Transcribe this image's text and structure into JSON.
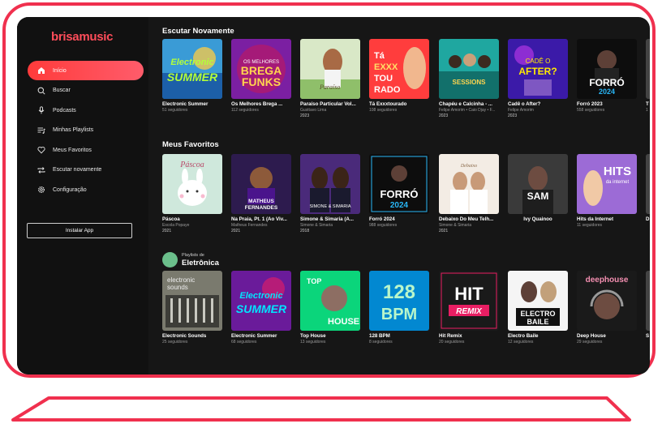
{
  "app": {
    "logo": "brisamusic"
  },
  "colors": {
    "accent": "#ff4152",
    "frame": "#f0304e",
    "bg": "#161616"
  },
  "sidebar": {
    "items": [
      {
        "label": "Início",
        "icon": "home-icon",
        "active": true
      },
      {
        "label": "Buscar",
        "icon": "search-icon"
      },
      {
        "label": "Podcasts",
        "icon": "microphone-icon"
      },
      {
        "label": "Minhas Playlists",
        "icon": "playlist-icon"
      },
      {
        "label": "Meus Favoritos",
        "icon": "heart-icon"
      },
      {
        "label": "Escutar novamente",
        "icon": "repeat-icon"
      },
      {
        "label": "Configuração",
        "icon": "gear-icon"
      }
    ],
    "install_label": "Instalar App"
  },
  "sections": {
    "listen_again": {
      "title": "Escutar Novamente",
      "cards": [
        {
          "title": "Electronic Summer",
          "sub": "51 seguidores",
          "year": "",
          "art": "ELECTRONIC SUMMER"
        },
        {
          "title": "Os Melhores Brega ...",
          "sub": "112 seguidores",
          "year": "",
          "art": "BREGA FUNKS"
        },
        {
          "title": "Paraíso Particular Vol...",
          "sub": "Gusttavo Lima",
          "year": "2023",
          "art": "Paraíso"
        },
        {
          "title": "Tá Exxxtourado",
          "sub": "108 seguidores",
          "year": "",
          "art": "TÁ EXXTOURADO"
        },
        {
          "title": "Chapéu e Calcinha - ...",
          "sub": "Felipe Amorim • Caio Djay • F...",
          "year": "2023",
          "art": "SESSIONS"
        },
        {
          "title": "Cadê o After?",
          "sub": "Felipe Amorim",
          "year": "2023",
          "art": "AFTER?"
        },
        {
          "title": "Forró 2023",
          "sub": "558 seguidores",
          "year": "",
          "art": "FORRÓ 2024"
        },
        {
          "title": "T",
          "sub": "1",
          "year": "",
          "art": ""
        }
      ]
    },
    "favorites": {
      "title": "Meus Favoritos",
      "cards": [
        {
          "title": "Páscoa",
          "sub": "Escola Popaye",
          "year": "2021",
          "art": "Páscoa"
        },
        {
          "title": "Na Praia, Pt. 1 (Ao Viv...",
          "sub": "Matheus Fernandes",
          "year": "2021",
          "art": "MATHEUS FERNANDES"
        },
        {
          "title": "Simone & Simaria (A...",
          "sub": "Simone & Simaria",
          "year": "2018",
          "art": "SIMONE & SIMARIA"
        },
        {
          "title": "Forró 2024",
          "sub": "988 seguidores",
          "year": "",
          "art": "FORRÓ 2024"
        },
        {
          "title": "Debaixo Do Meu Telh...",
          "sub": "Simone & Simaria",
          "year": "2021",
          "art": "Debaixo"
        },
        {
          "title": "Ivy Quainoo",
          "sub": "",
          "year": "",
          "art": "SAM"
        },
        {
          "title": "Hits da Internet",
          "sub": "11 seguidores",
          "year": "",
          "art": "HITS da internet"
        },
        {
          "title": "D",
          "sub": "",
          "year": "",
          "art": ""
        }
      ]
    },
    "electronic": {
      "small": "Playlists de",
      "title": "Eletrônica",
      "cards": [
        {
          "title": "Electronic Sounds",
          "sub": "25 seguidores",
          "art": "electronic sounds"
        },
        {
          "title": "Electronic Summer",
          "sub": "68 seguidores",
          "art": "ELECTRONIC SUMMER"
        },
        {
          "title": "Top House",
          "sub": "13 seguidores",
          "art": "TOP HOUSE"
        },
        {
          "title": "128 BPM",
          "sub": "8 seguidores",
          "art": "128 BPM"
        },
        {
          "title": "Hit Remix",
          "sub": "20 seguidores",
          "art": "HIT REMIX"
        },
        {
          "title": "Electro Baile",
          "sub": "12 seguidores",
          "art": "ELECTRO BAILE"
        },
        {
          "title": "Deep House",
          "sub": "29 seguidores",
          "art": "deephouse"
        },
        {
          "title": "S",
          "sub": "",
          "art": ""
        }
      ]
    }
  }
}
